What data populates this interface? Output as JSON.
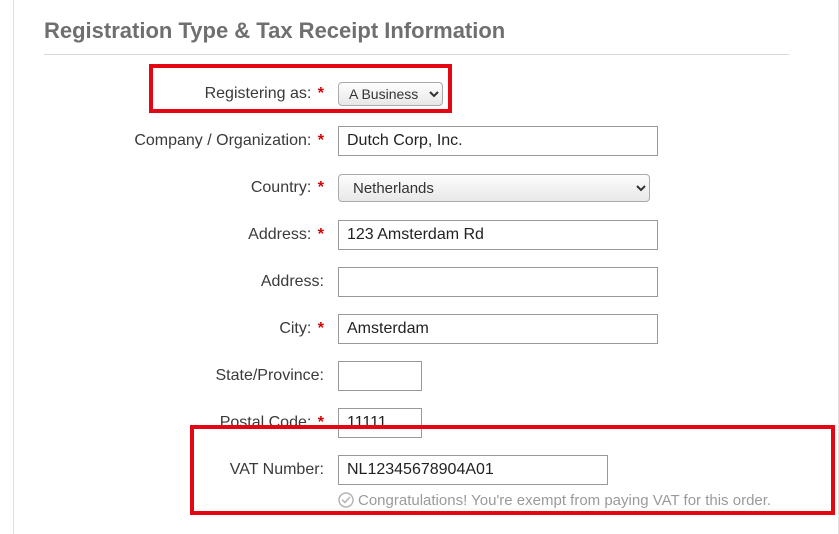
{
  "section_title": "Registration Type & Tax Receipt Information",
  "fields": {
    "registering_as": {
      "label": "Registering as:",
      "required": true,
      "value": "A Business"
    },
    "company": {
      "label": "Company / Organization:",
      "required": true,
      "value": "Dutch Corp, Inc."
    },
    "country": {
      "label": "Country:",
      "required": true,
      "value": "Netherlands"
    },
    "address1": {
      "label": "Address:",
      "required": true,
      "value": "123 Amsterdam Rd"
    },
    "address2": {
      "label": "Address:",
      "required": false,
      "value": ""
    },
    "city": {
      "label": "City:",
      "required": true,
      "value": "Amsterdam"
    },
    "state": {
      "label": "State/Province:",
      "required": false,
      "value": ""
    },
    "postal": {
      "label": "Postal Code:",
      "required": true,
      "value": "11111"
    },
    "vat": {
      "label": "VAT Number:",
      "required": false,
      "value": "NL12345678904A01"
    }
  },
  "vat_message": "Congratulations! You're exempt from paying VAT for this order."
}
